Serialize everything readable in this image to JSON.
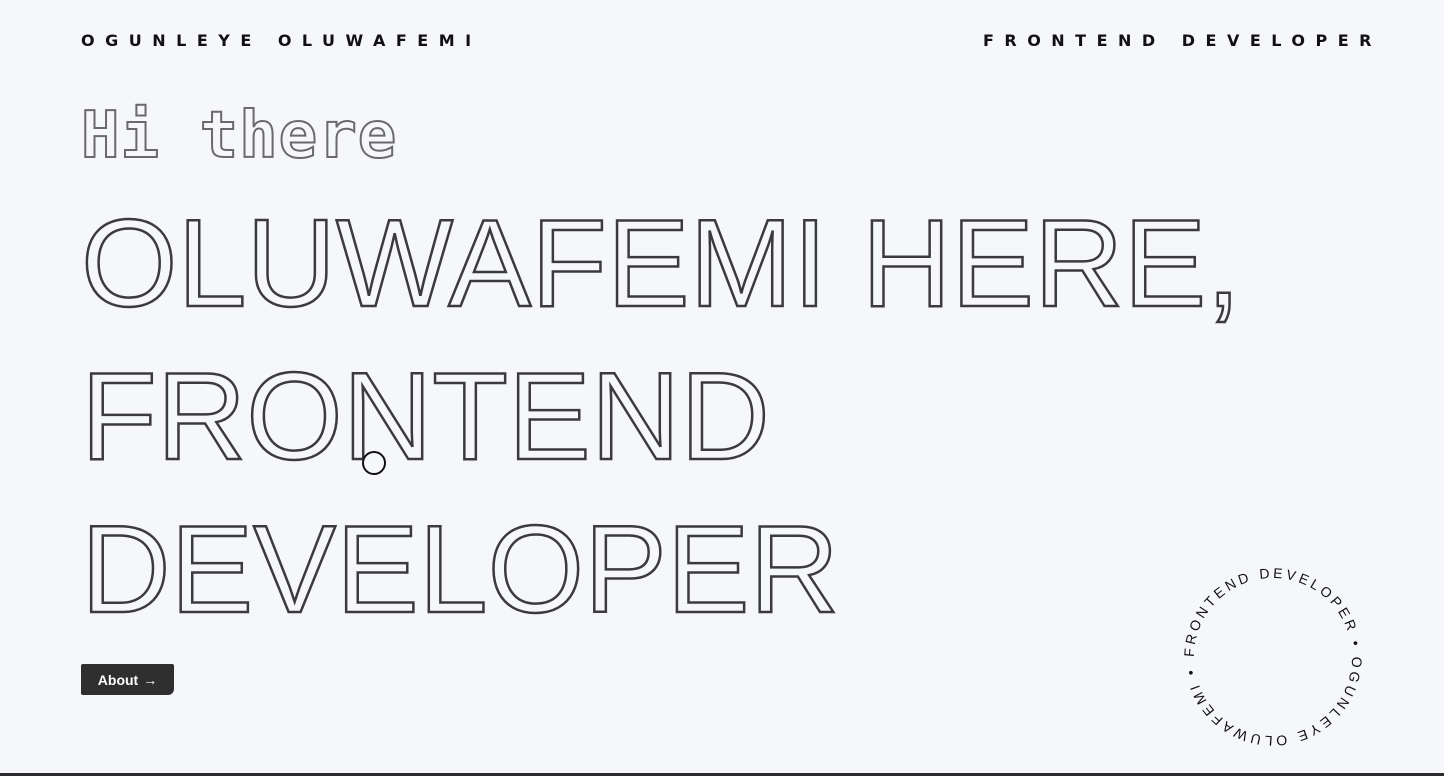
{
  "header": {
    "brand": "OGUNLEYE OLUWAFEMI",
    "role": "FRONTEND DEVELOPER"
  },
  "hero": {
    "greeting": "Hi there",
    "headline_lines": [
      "OLUWAFEMI HERE,",
      "FRONTEND",
      "DEVELOPER"
    ]
  },
  "about_button": {
    "label": "About",
    "icon": "arrow-right-icon"
  },
  "badge": {
    "circle_text": "FRONTEND DEVELOPER • OGUNLEYE OLUWAFEMI • "
  },
  "colors": {
    "background": "#f6f7fb",
    "text": "#111111",
    "outline": "#3b3b3b",
    "greeting_outline": "#6a6a6a",
    "button_bg": "#2f2f2f",
    "button_text": "#ffffff"
  }
}
